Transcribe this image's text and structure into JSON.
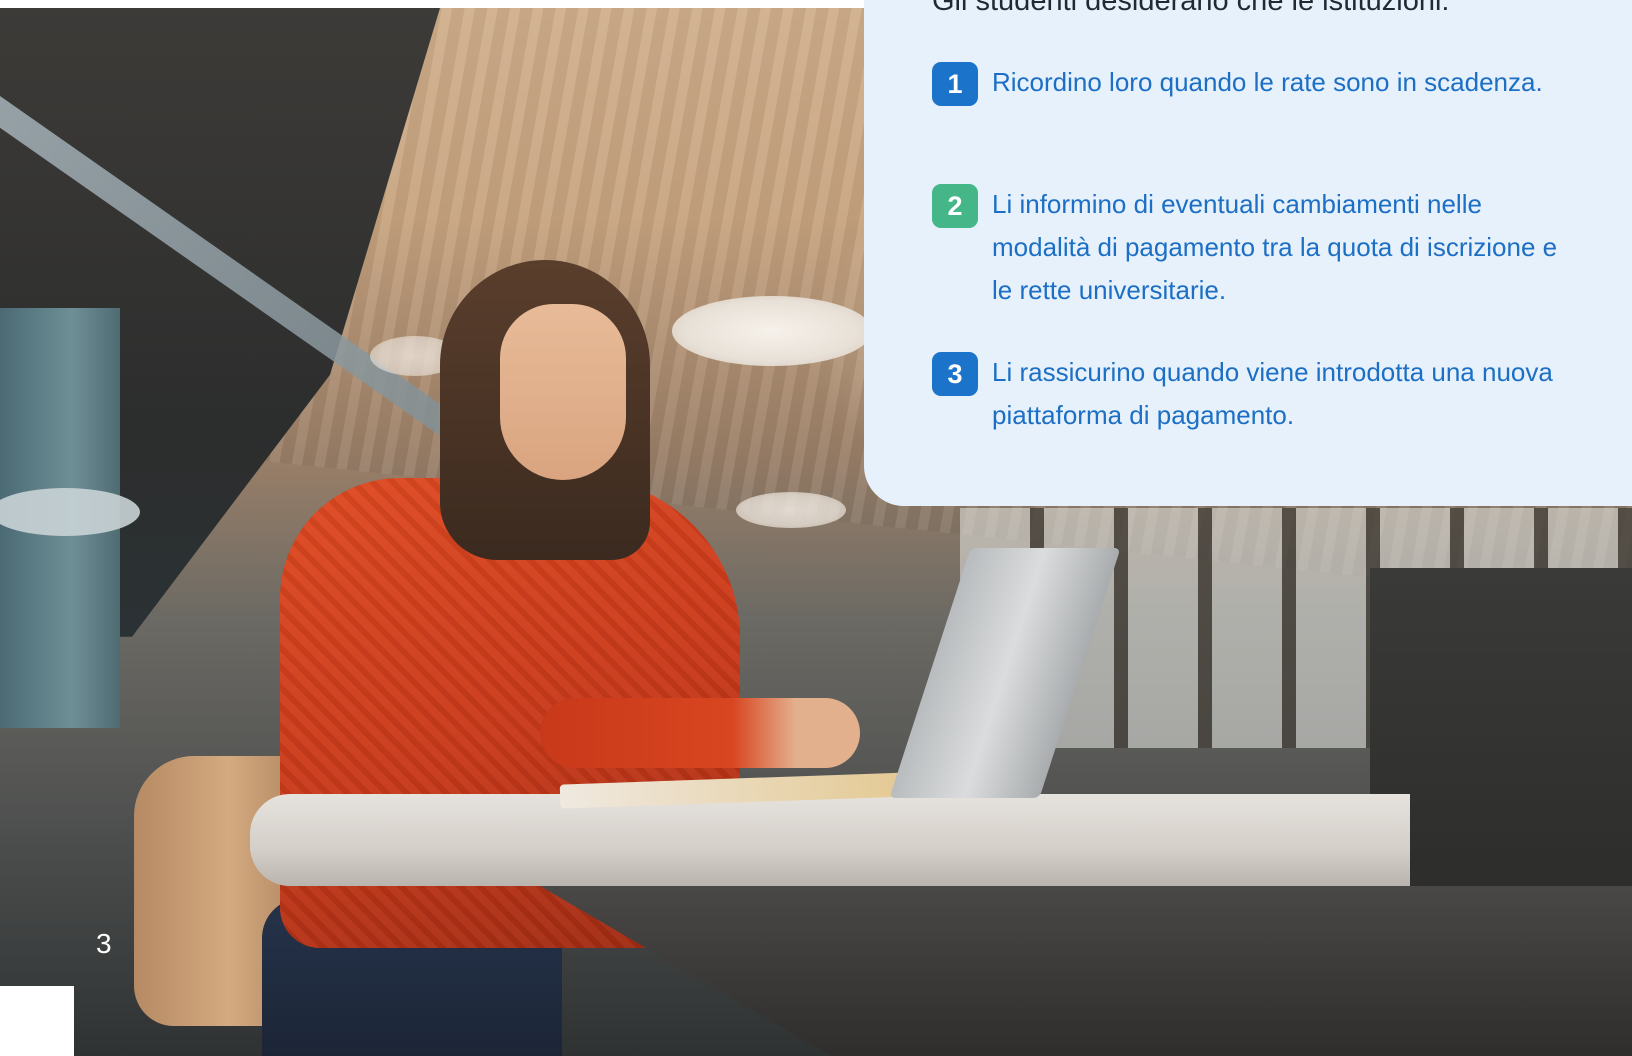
{
  "panel": {
    "heading": "Gli studenti desiderano che le istituzioni:",
    "items": [
      {
        "number": "1",
        "badge_color": "#1b74c9",
        "text": "Ricordino loro quando le rate sono in scadenza."
      },
      {
        "number": "2",
        "badge_color": "#45b688",
        "text": "Li informino di eventuali cambiamenti nelle modalità di pagamento tra la quota di iscrizione e le rette universitarie."
      },
      {
        "number": "3",
        "badge_color": "#1b74c9",
        "text": "Li rassicurino quando viene introdotta una nuova piattaforma di pagamento."
      }
    ]
  },
  "page_number": "3",
  "colors": {
    "panel_background": "#e6f1fb",
    "text_blue": "#1c6fc4",
    "heading_dark": "#1f2a36"
  }
}
